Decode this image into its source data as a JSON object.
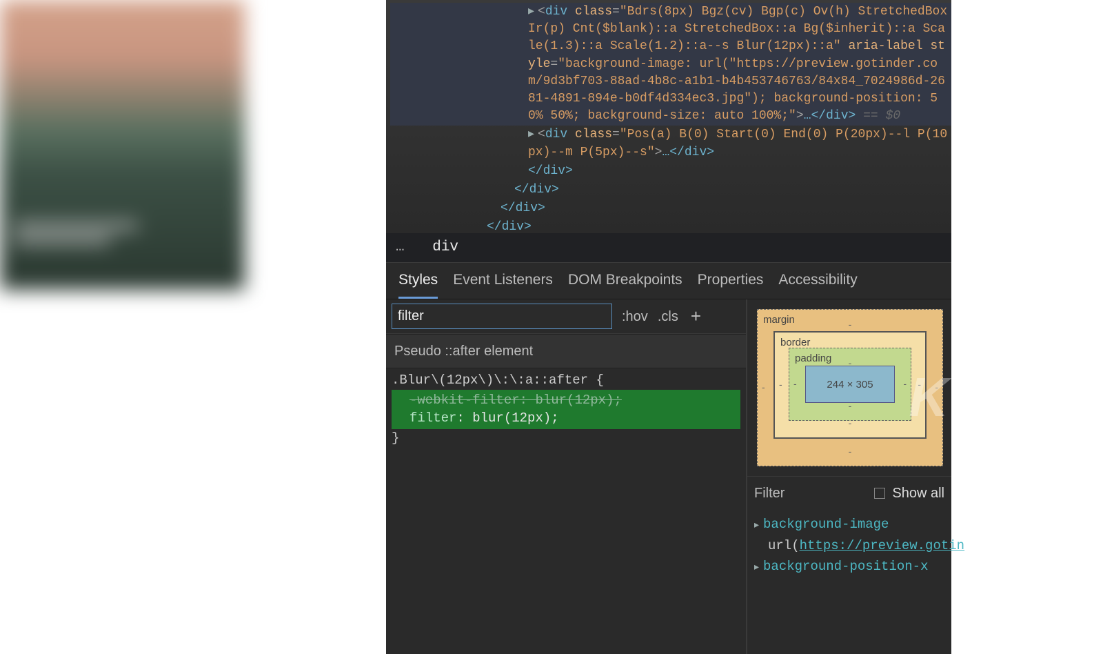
{
  "elements": {
    "line1_tag": "div",
    "line1_class_attr": "class",
    "line1_class_val": "\"Bdrs(8px) Bgz(cv) Bgp(c) Ov(h) StretchedBox Ir(p) Cnt($blank)::a StretchedBox::a Bg($inherit)::a Scale(1.3)::a Scale(1.2)::a--s Blur(12px)::a\"",
    "line1_aria": "aria-label",
    "line1_style_attr": "style",
    "line1_style_val": "\"background-image: url(\"https://preview.gotinder.com/9d3bf703-88ad-4b8c-a1b1-b4b453746763/84x84_7024986d-2681-4891-894e-b0df4d334ec3.jpg\"); background-position: 50% 50%; background-size: auto 100%;\"",
    "line1_close": "…</div>",
    "line1_eq": " == $0",
    "line2_tag": "div",
    "line2_class_val": "\"Pos(a) B(0) Start(0) End(0) P(20px)--l P(10px)--m P(5px)--s\"",
    "line2_close": "…</div>",
    "d1": "</div>",
    "d2": "</div>",
    "d3": "</div>",
    "d4": "</div>"
  },
  "breadcrumb": {
    "ellipsis": "…",
    "current": "div"
  },
  "tabs": {
    "styles": "Styles",
    "listeners": "Event Listeners",
    "dom": "DOM Breakpoints",
    "props": "Properties",
    "a11y": "Accessibility"
  },
  "filter": {
    "value": "filter",
    "hov": ":hov",
    "cls": ".cls",
    "plus": "+"
  },
  "pseudo_section": "Pseudo ::after element",
  "rule": {
    "selector": ".Blur\\(12px\\)\\:\\:a::after {",
    "decl1_prop": "-webkit-filter",
    "decl1_val": "blur(12px)",
    "decl2_prop": "filter",
    "decl2_val": "blur(12px)",
    "close": "}"
  },
  "boxmodel": {
    "margin": "margin",
    "border": "border",
    "padding": "padding",
    "content": "244 × 305",
    "dash": "-"
  },
  "computed": {
    "filter_label": "Filter",
    "show_all": "Show all",
    "p1": "background-image",
    "p1_val_prefix": "url(",
    "p1_val_url": "https://preview.gotin",
    "p2": "background-position-x"
  },
  "watermark": "K"
}
